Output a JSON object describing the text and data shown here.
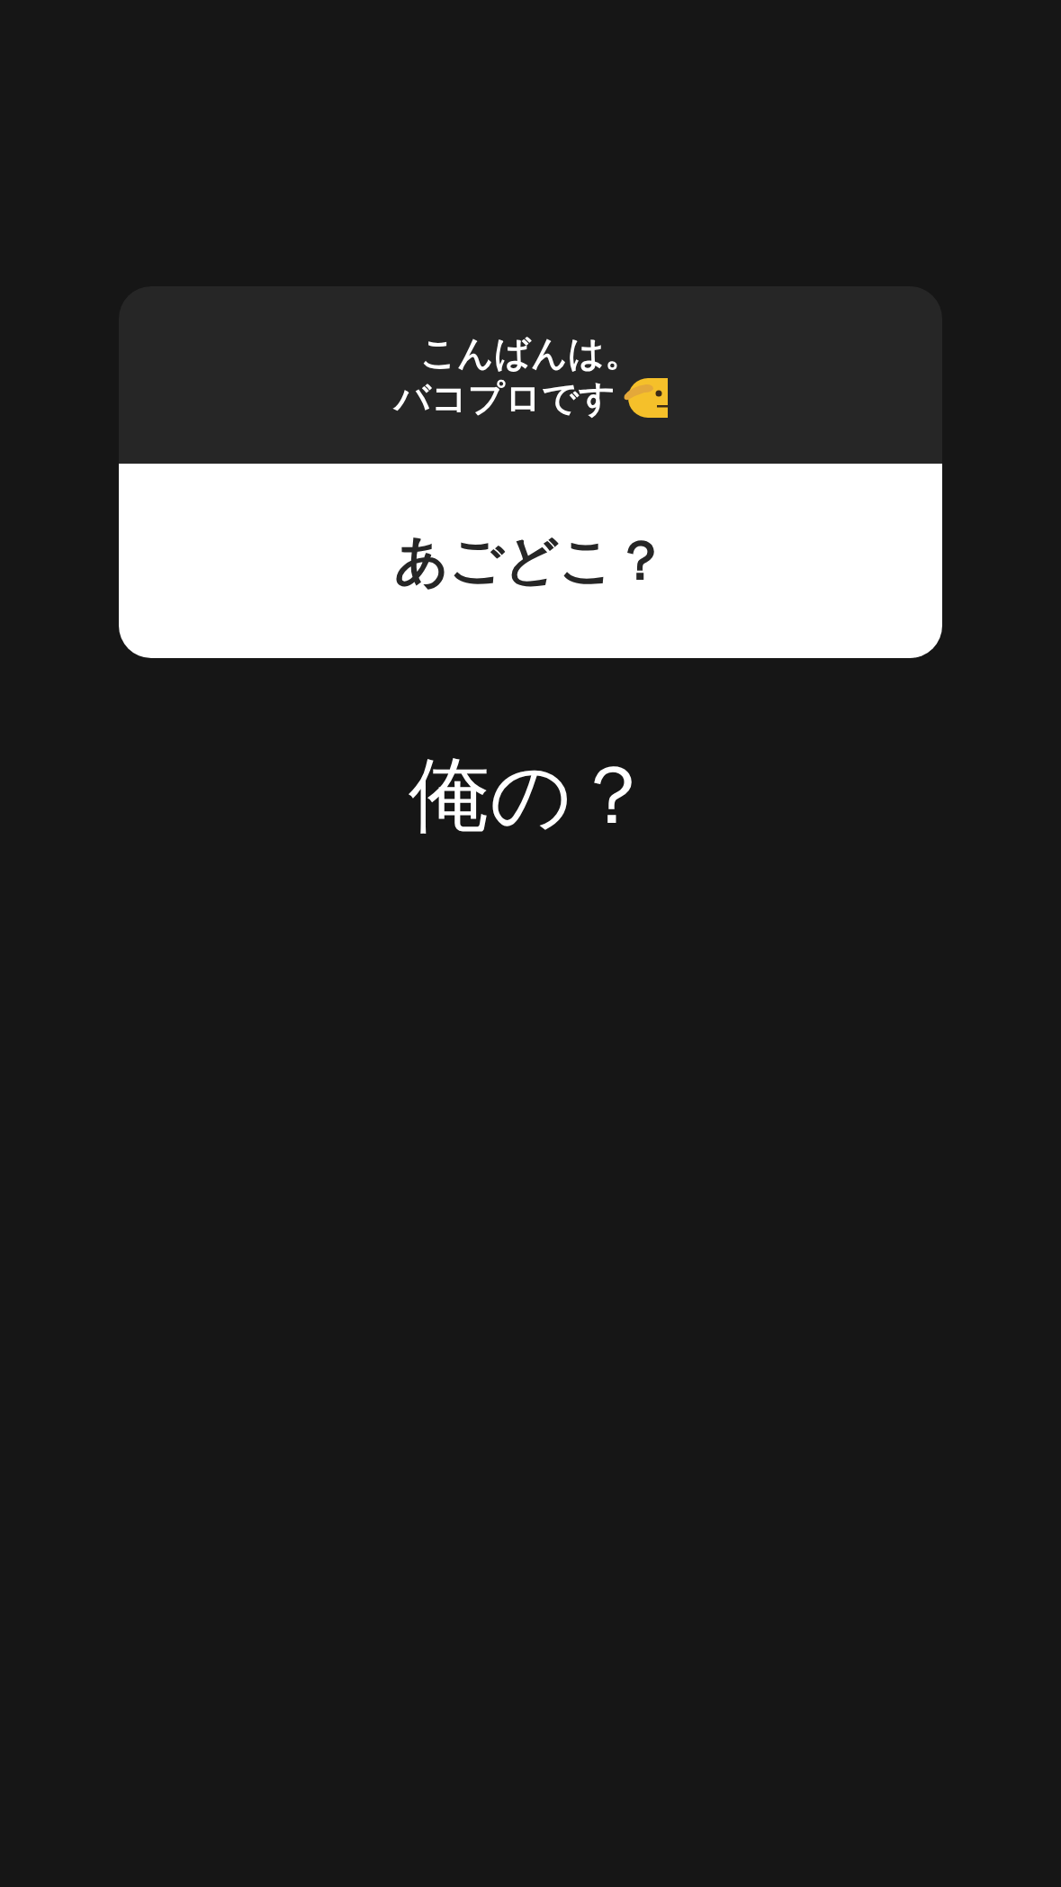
{
  "question_card": {
    "question_lines": [
      "こんばんは。",
      "バコプロです"
    ],
    "answer": "あごどこ？"
  },
  "reply_text": "俺の？"
}
